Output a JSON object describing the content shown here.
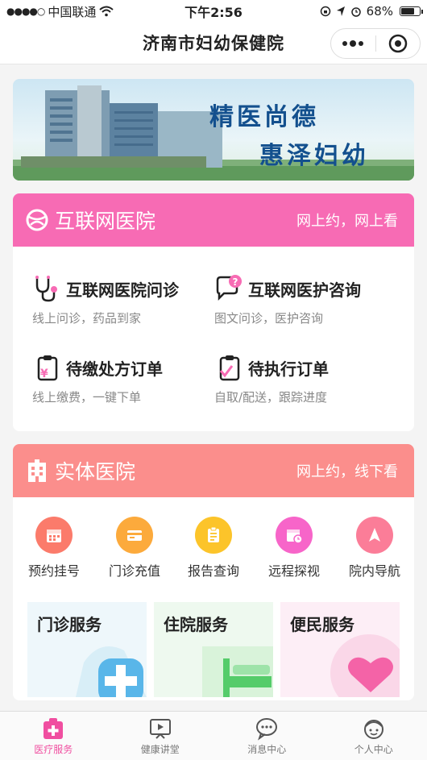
{
  "status": {
    "carrier": "中国联通",
    "time": "下午2:56",
    "battery": "68%",
    "battery_level": 0.68
  },
  "nav": {
    "title": "济南市妇幼保健院"
  },
  "banner": {
    "line1": "精医尚德",
    "line2": "惠泽妇幼"
  },
  "internet": {
    "title": "互联网医院",
    "subtitle": "网上约，网上看",
    "color": "#f76bb4",
    "services": [
      {
        "name": "互联网医院问诊",
        "desc": "线上问诊，药品到家",
        "icon": "stethoscope-icon"
      },
      {
        "name": "互联网医护咨询",
        "desc": "图文问诊，医护咨询",
        "icon": "chat-question-icon"
      },
      {
        "name": "待缴处方订单",
        "desc": "线上缴费，一键下单",
        "icon": "yuan-clipboard-icon"
      },
      {
        "name": "待执行订单",
        "desc": "自取/配送，跟踪进度",
        "icon": "check-clipboard-icon"
      }
    ]
  },
  "physical": {
    "title": "实体医院",
    "subtitle": "网上约，线下看",
    "color": "#fb8e8c",
    "quick": [
      {
        "label": "预约挂号",
        "icon": "calendar-icon",
        "color": "#fb7b6b"
      },
      {
        "label": "门诊充值",
        "icon": "card-icon",
        "color": "#fcaa3c"
      },
      {
        "label": "报告查询",
        "icon": "report-icon",
        "color": "#fcc42a"
      },
      {
        "label": "远程探视",
        "icon": "calendar-clock-icon",
        "color": "#f765c9"
      },
      {
        "label": "院内导航",
        "icon": "navigation-icon",
        "color": "#fb7d98"
      }
    ],
    "tiles": [
      {
        "label": "门诊服务",
        "icon": "medical-cross-icon"
      },
      {
        "label": "住院服务",
        "icon": "bed-icon"
      },
      {
        "label": "便民服务",
        "icon": "heart-icon"
      }
    ]
  },
  "tabs": [
    {
      "label": "医疗服务",
      "icon": "medical-box-icon",
      "active": true
    },
    {
      "label": "健康讲堂",
      "icon": "play-screen-icon",
      "active": false
    },
    {
      "label": "消息中心",
      "icon": "message-icon",
      "active": false
    },
    {
      "label": "个人中心",
      "icon": "user-face-icon",
      "active": false
    }
  ]
}
